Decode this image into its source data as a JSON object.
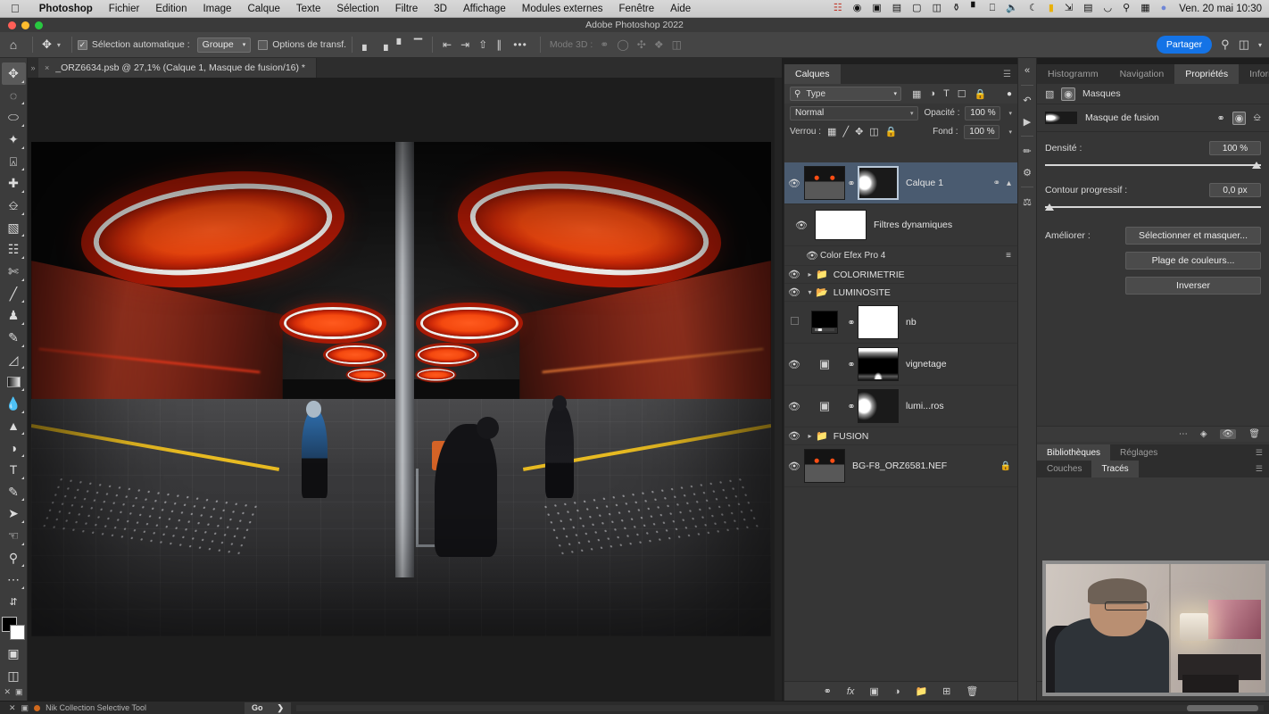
{
  "macbar": {
    "apple": "",
    "menus": [
      {
        "label": "Photoshop",
        "bold": true
      },
      {
        "label": "Fichier"
      },
      {
        "label": "Edition"
      },
      {
        "label": "Image"
      },
      {
        "label": "Calque"
      },
      {
        "label": "Texte"
      },
      {
        "label": "Sélection"
      },
      {
        "label": "Filtre"
      },
      {
        "label": "3D"
      },
      {
        "label": "Affichage"
      },
      {
        "label": "Modules externes"
      },
      {
        "label": "Fenêtre"
      },
      {
        "label": "Aide"
      }
    ],
    "status_icons": [
      "creative-cloud-icon",
      "dropbox-icon",
      "screenshot-icon",
      "record-icon",
      "display-icon",
      "clipboard-icon",
      "search-tool-icon",
      "columns-icon",
      "monitor-icon",
      "volume-icon",
      "moon-icon",
      "flag-icon",
      "bluetooth-icon",
      "battery-icon",
      "wifi-icon",
      "spotlight-icon",
      "airplay-icon",
      "siri-icon"
    ],
    "clock": "Ven. 20 mai  10:30"
  },
  "titlebar": {
    "title": "Adobe Photoshop 2022"
  },
  "optionsbar": {
    "home_icon": "home-icon",
    "tool_icon": "move-tool-icon",
    "auto_select_label": "Sélection automatique :",
    "auto_select_checked": true,
    "group_value": "Groupe",
    "transform_label": "Options de transf.",
    "transform_checked": false,
    "mode3d_label": "Mode 3D :",
    "more_label": "•••",
    "share_label": "Partager",
    "right_icons": [
      "search-icon",
      "workspace-icon",
      "chevron-down-icon"
    ]
  },
  "toolbar": {
    "tools": [
      {
        "name": "move-tool",
        "glyph": "✥",
        "active": true
      },
      {
        "name": "marquee-tool",
        "glyph": "◌"
      },
      {
        "name": "lasso-tool",
        "glyph": "◯"
      },
      {
        "name": "quick-selection-tool",
        "glyph": "✧"
      },
      {
        "name": "crop-tool",
        "glyph": "⌗"
      },
      {
        "name": "eyedropper-tool",
        "glyph": "✎"
      },
      {
        "name": "healing-brush-tool",
        "glyph": "✚"
      },
      {
        "name": "brush-tool",
        "glyph": "🖌"
      },
      {
        "name": "pattern-stamp-tool",
        "glyph": "▩"
      },
      {
        "name": "history-brush-tool",
        "glyph": "✂"
      },
      {
        "name": "paint-brush-tool",
        "glyph": "╱"
      },
      {
        "name": "clone-stamp-tool",
        "glyph": "♟"
      },
      {
        "name": "art-history-tool",
        "glyph": "✐"
      },
      {
        "name": "eraser-tool",
        "glyph": "◣"
      },
      {
        "name": "gradient-tool",
        "glyph": "▬"
      },
      {
        "name": "blur-tool",
        "glyph": "💧"
      },
      {
        "name": "dodge-tool",
        "glyph": "◒"
      },
      {
        "name": "pen-tool",
        "glyph": "✒"
      },
      {
        "name": "type-tool",
        "glyph": "T"
      },
      {
        "name": "path-selection-tool",
        "glyph": "➤"
      },
      {
        "name": "direct-selection-tool",
        "glyph": "➚"
      },
      {
        "name": "hand-tool",
        "glyph": "✋"
      },
      {
        "name": "zoom-tool",
        "glyph": "⚲"
      },
      {
        "name": "edit-toolbar",
        "glyph": "•••"
      }
    ],
    "swap_icon": "swap-colors-icon",
    "default_icon": "default-colors-icon",
    "quickmask_icon": "quick-mask-icon",
    "screenmode_icon": "screen-mode-icon"
  },
  "document": {
    "tab_title": "_ORZ6634.psb @ 27,1% (Calque 1, Masque de fusion/16) *",
    "close_glyph": "×"
  },
  "layers_panel": {
    "tabs": [
      {
        "label": "Calques",
        "active": true
      }
    ],
    "menu_icon": "panel-menu-icon",
    "filter": {
      "search_icon": "search-icon",
      "value": "Type",
      "icons": [
        "pixel-filter-icon",
        "adjustment-filter-icon",
        "type-filter-icon",
        "shape-filter-icon",
        "smartobject-filter-icon"
      ],
      "toggle_icon": "filter-toggle-icon"
    },
    "blend_mode": "Normal",
    "opacity_label": "Opacité :",
    "opacity_value": "100 %",
    "lock_label": "Verrou :",
    "lock_icons": [
      "lock-transparency-icon",
      "lock-image-icon",
      "lock-position-icon",
      "lock-artboard-icon",
      "lock-all-icon"
    ],
    "fill_label": "Fond :",
    "fill_value": "100 %",
    "layers": [
      {
        "name": "Calque 1",
        "visible": true,
        "selected": true,
        "type": "smart-object",
        "has_mask": true,
        "right_icons": [
          "smart-filter-icon",
          "chevron-up-icon"
        ]
      },
      {
        "name": "Filtres dynamiques",
        "visible": true,
        "type": "smart-filters-header"
      },
      {
        "name": "Color Efex Pro 4",
        "visible": true,
        "type": "smart-filter"
      },
      {
        "name": "COLORIMETRIE",
        "visible": true,
        "type": "group",
        "expanded": false
      },
      {
        "name": "LUMINOSITE",
        "visible": true,
        "type": "group",
        "expanded": true
      },
      {
        "name": "nb",
        "visible": false,
        "type": "adjustment-bw",
        "has_mask": true
      },
      {
        "name": "vignetage",
        "visible": true,
        "type": "adjustment-curves",
        "has_mask": true
      },
      {
        "name": "lumi...ros",
        "visible": true,
        "type": "adjustment-curves",
        "has_mask": true
      },
      {
        "name": "FUSION",
        "visible": true,
        "type": "group",
        "expanded": false
      },
      {
        "name": "BG-F8_ORZ6581.NEF",
        "visible": true,
        "type": "image",
        "locked": true
      }
    ],
    "bottom_icons": [
      "link-layers-icon",
      "add-fx-icon",
      "add-mask-icon",
      "add-adjustment-icon",
      "new-group-icon",
      "new-layer-icon",
      "delete-layer-icon"
    ]
  },
  "icon_dock": {
    "collapse_icon": "collapse-panels-icon",
    "icons": [
      "history-icon",
      "actions-play-icon",
      "brush-settings-icon",
      "adjustments-icon",
      "styles-icon"
    ]
  },
  "properties_panel": {
    "tabs": [
      {
        "label": "Histogramm",
        "active": false
      },
      {
        "label": "Navigation",
        "active": false
      },
      {
        "label": "Propriétés",
        "active": true
      },
      {
        "label": "Informations",
        "active": false
      }
    ],
    "menu_icon": "panel-menu-icon",
    "section_title": "Masques",
    "section_icons": [
      "pixel-mask-icon",
      "vector-mask-icon"
    ],
    "mask_row_label": "Masque de fusion",
    "mask_row_icons": [
      "select-mask-icon",
      "apply-mask-icon",
      "disable-mask-icon"
    ],
    "density_label": "Densité :",
    "density_value": "100 %",
    "feather_label": "Contour progressif :",
    "feather_value": "0,0 px",
    "improve_label": "Améliorer :",
    "buttons": [
      "Sélectionner et masquer...",
      "Plage de couleurs...",
      "Inverser"
    ],
    "footer_icons": [
      "load-selection-icon",
      "apply-mask-icon",
      "toggle-mask-icon",
      "delete-mask-icon"
    ]
  },
  "lower_panels": {
    "group1": [
      {
        "label": "Bibliothèques",
        "active": true
      },
      {
        "label": "Réglages",
        "active": false
      }
    ],
    "group2": [
      {
        "label": "Couches",
        "active": false
      },
      {
        "label": "Tracés",
        "active": true
      }
    ],
    "menu_icon": "panel-menu-icon",
    "bottom_icons": [
      "fill-path-icon",
      "stroke-path-icon",
      "load-selection-icon",
      "make-path-icon",
      "add-mask-icon",
      "new-path-icon",
      "delete-path-icon"
    ]
  },
  "statusbar": {
    "left_icons": [
      "quick-mask-icon",
      "screen-mode-icon"
    ],
    "plugin_dot": "nik-collection-dot-icon",
    "plugin_label": "Nik Collection Selective Tool",
    "go_label": "Go",
    "go_caret": "❯"
  },
  "webcam": {
    "name": "webcam-overlay"
  }
}
